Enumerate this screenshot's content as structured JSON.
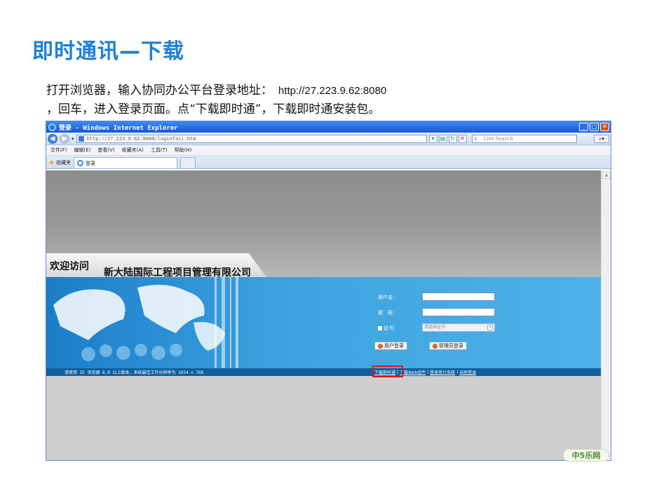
{
  "slide": {
    "title": "即时通讯—下载",
    "intro_line1": "打开浏览器，输入协同办公平台登录地址：",
    "intro_url": "http://27.223.9.62:8080",
    "intro_line2": "，回车，进入登录页面。点“下载即时通”，下载即时通安装包。"
  },
  "browser": {
    "window_title": "登录 - Windows Internet Explorer",
    "address": "http://27.223.9.62:8080/loginfail.htm",
    "search_placeholder": "Live Search",
    "menu": [
      "文件(F)",
      "编辑(E)",
      "查看(V)",
      "收藏夹(A)",
      "工具(T)",
      "帮助(H)"
    ],
    "favorites_label": "收藏夹",
    "tab_label": "登录"
  },
  "page": {
    "welcome": "欢迎访问",
    "company": "新大陆国际工程项目管理有限公司",
    "username_label": "用户名：",
    "password_label": "密　码：",
    "cert_label": "证书：",
    "cert_placeholder": "请选择证书",
    "user_login": "用户登录",
    "admin_login": "管理员登录",
    "footer_note": "请使用 IE 浏览器 6.0 以上版本，系统最佳工作分辨率为 1024 x 768",
    "footer_links": [
      "下载即时通",
      "下载Web组件",
      "登录审计系统",
      "自助登录"
    ],
    "separator": "|"
  },
  "logo_text": "中5乐网",
  "colors": {
    "title_blue": "#1f7fd6",
    "banner_blue": "#3ea4e0",
    "highlight_red": "#e01818"
  }
}
